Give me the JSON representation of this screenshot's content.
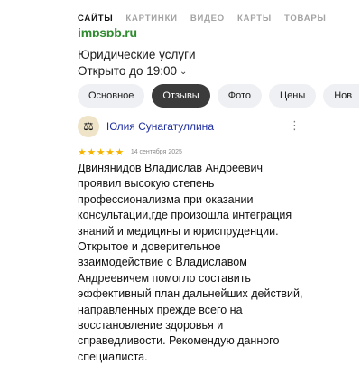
{
  "search_tabs": {
    "items": [
      "САЙТЫ",
      "КАРТИНКИ",
      "ВИДЕО",
      "КАРТЫ",
      "ТОВАРЫ"
    ],
    "active_index": 0
  },
  "organization": {
    "site": "impspb.ru",
    "category": "Юридические услуги",
    "hours": "Открыто до 19:00"
  },
  "chips": {
    "items": [
      "Основное",
      "Отзывы",
      "Фото",
      "Цены",
      "Нов"
    ],
    "active_index": 1
  },
  "review": {
    "author": "Юлия Сунагатуллина",
    "rating": 5,
    "rating_max": 5,
    "date": "14 сентября 2025",
    "lines": [
      "Двинянидов Владислав Андреевич",
      "проявил высокую степень",
      "профессионализма при оказании",
      "консультации,где произошла интеграция",
      "знаний и медицины и юриспруденции.",
      "Открытое и доверительное",
      "взаимодействие с Владиславом",
      "Андреевичем помогло составить",
      "эффективный план дальнейших действий,",
      "направленных прежде всего на",
      "восстановление здоровья и",
      "справедливости. Рекомендую данного",
      "специалиста."
    ]
  },
  "icons": {
    "chevron": "chevron-down-icon",
    "avatar": "scales-avatar-icon",
    "more": "more-vertical-icon",
    "star_color": "#f6b400"
  }
}
